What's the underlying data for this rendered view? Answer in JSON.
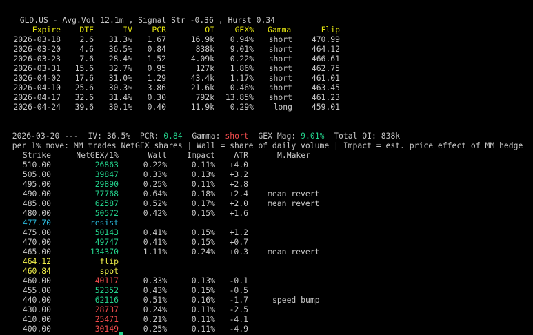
{
  "header": {
    "title": "GLD.US - Avg.Vol 12.1m , Signal Str -0.36 , Hurst 0.34"
  },
  "expiry_table": {
    "columns": [
      "Expire",
      "DTE",
      "IV",
      "PCR",
      "OI",
      "GEX%",
      "Gamma",
      "Flip"
    ],
    "rows": [
      {
        "expire": "2026-03-18",
        "dte": "2.6",
        "iv": "31.3%",
        "pcr": "1.67",
        "oi": "16.9k",
        "gex": "0.94%",
        "gamma": "short",
        "flip": "470.99"
      },
      {
        "expire": "2026-03-20",
        "dte": "4.6",
        "iv": "36.5%",
        "pcr": "0.84",
        "oi": "838k",
        "gex": "9.01%",
        "gamma": "short",
        "flip": "464.12"
      },
      {
        "expire": "2026-03-23",
        "dte": "7.6",
        "iv": "28.4%",
        "pcr": "1.52",
        "oi": "4.09k",
        "gex": "0.22%",
        "gamma": "short",
        "flip": "466.61"
      },
      {
        "expire": "2026-03-31",
        "dte": "15.6",
        "iv": "32.7%",
        "pcr": "0.95",
        "oi": "127k",
        "gex": "1.86%",
        "gamma": "short",
        "flip": "462.75"
      },
      {
        "expire": "2026-04-02",
        "dte": "17.6",
        "iv": "31.0%",
        "pcr": "1.29",
        "oi": "43.4k",
        "gex": "1.17%",
        "gamma": "short",
        "flip": "461.01"
      },
      {
        "expire": "2026-04-10",
        "dte": "25.6",
        "iv": "30.3%",
        "pcr": "3.86",
        "oi": "21.6k",
        "gex": "0.46%",
        "gamma": "short",
        "flip": "463.45"
      },
      {
        "expire": "2026-04-17",
        "dte": "32.6",
        "iv": "31.4%",
        "pcr": "0.30",
        "oi": "792k",
        "gex": "13.85%",
        "gamma": "short",
        "flip": "461.23"
      },
      {
        "expire": "2026-04-24",
        "dte": "39.6",
        "iv": "30.1%",
        "pcr": "0.40",
        "oi": "11.9k",
        "gex": "0.29%",
        "gamma": "long",
        "flip": "459.01"
      }
    ]
  },
  "summary": {
    "date": "2026-03-20",
    "sep": "---",
    "iv_label": "IV:",
    "iv_value": "36.5%",
    "pcr_label": "PCR:",
    "pcr_value": "0.84",
    "gamma_label": "Gamma:",
    "gamma_value": "short",
    "gex_label": "GEX Mag:",
    "gex_value": "9.01%",
    "oi_label": "Total OI:",
    "oi_value": "838k"
  },
  "legend_line": "per 1% move: MM trades NetGEX shares | Wall = share of daily volume | Impact = est. price effect of MM hedge",
  "strike_table": {
    "columns": [
      "Strike",
      "NetGEX/1%",
      "Wall",
      "Impact",
      "ATR",
      "M.Maker"
    ],
    "rows": [
      {
        "kind": "row",
        "strike": "510.00",
        "netgex": "26863",
        "sign": "pos",
        "wall": "0.22%",
        "impact": "0.11%",
        "atr": "+4.0",
        "mm": ""
      },
      {
        "kind": "row",
        "strike": "505.00",
        "netgex": "39847",
        "sign": "pos",
        "wall": "0.33%",
        "impact": "0.13%",
        "atr": "+3.2",
        "mm": ""
      },
      {
        "kind": "row",
        "strike": "495.00",
        "netgex": "29890",
        "sign": "pos",
        "wall": "0.25%",
        "impact": "0.11%",
        "atr": "+2.8",
        "mm": ""
      },
      {
        "kind": "row",
        "strike": "490.00",
        "netgex": "77768",
        "sign": "pos",
        "wall": "0.64%",
        "impact": "0.18%",
        "atr": "+2.4",
        "mm": "mean revert"
      },
      {
        "kind": "row",
        "strike": "485.00",
        "netgex": "62587",
        "sign": "pos",
        "wall": "0.52%",
        "impact": "0.17%",
        "atr": "+2.0",
        "mm": "mean revert"
      },
      {
        "kind": "row",
        "strike": "480.00",
        "netgex": "50572",
        "sign": "pos",
        "wall": "0.42%",
        "impact": "0.15%",
        "atr": "+1.6",
        "mm": ""
      },
      {
        "kind": "marker",
        "strike": "477.70",
        "label": "resist",
        "style": "cyan"
      },
      {
        "kind": "row",
        "strike": "475.00",
        "netgex": "50143",
        "sign": "pos",
        "wall": "0.41%",
        "impact": "0.15%",
        "atr": "+1.2",
        "mm": ""
      },
      {
        "kind": "row",
        "strike": "470.00",
        "netgex": "49747",
        "sign": "pos",
        "wall": "0.41%",
        "impact": "0.15%",
        "atr": "+0.7",
        "mm": ""
      },
      {
        "kind": "row",
        "strike": "465.00",
        "netgex": "134370",
        "sign": "pos",
        "wall": "1.11%",
        "impact": "0.24%",
        "atr": "+0.3",
        "mm": "mean revert"
      },
      {
        "kind": "marker",
        "strike": "464.12",
        "label": "flip",
        "style": "yellow"
      },
      {
        "kind": "marker",
        "strike": "460.84",
        "label": "spot",
        "style": "yellow"
      },
      {
        "kind": "row",
        "strike": "460.00",
        "netgex": "40117",
        "sign": "neg",
        "wall": "0.33%",
        "impact": "0.13%",
        "atr": "-0.1",
        "mm": ""
      },
      {
        "kind": "row",
        "strike": "455.00",
        "netgex": "52352",
        "sign": "pos",
        "wall": "0.43%",
        "impact": "0.15%",
        "atr": "-0.5",
        "mm": ""
      },
      {
        "kind": "row",
        "strike": "440.00",
        "netgex": "62116",
        "sign": "pos",
        "wall": "0.51%",
        "impact": "0.16%",
        "atr": "-1.7",
        "mm": "speed bump"
      },
      {
        "kind": "row",
        "strike": "430.00",
        "netgex": "28737",
        "sign": "neg",
        "wall": "0.24%",
        "impact": "0.11%",
        "atr": "-2.5",
        "mm": ""
      },
      {
        "kind": "row",
        "strike": "410.00",
        "netgex": "25471",
        "sign": "neg",
        "wall": "0.21%",
        "impact": "0.11%",
        "atr": "-4.1",
        "mm": ""
      },
      {
        "kind": "row",
        "strike": "400.00",
        "netgex": "30149",
        "sign": "neg",
        "wall": "0.25%",
        "impact": "0.11%",
        "atr": "-4.9",
        "mm": ""
      }
    ]
  },
  "colors": {
    "background": "#000000",
    "text": "#c7c7c7",
    "header": "#e5e510",
    "positive": "#23d18b",
    "negative": "#f14c4c",
    "resist": "#29b8db",
    "flip_spot": "#f2f24a",
    "cursor": "#23d18b"
  }
}
